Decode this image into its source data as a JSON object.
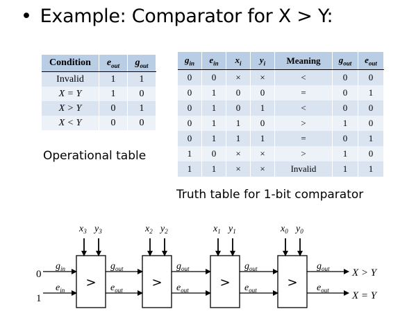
{
  "title": {
    "bullet": "•",
    "text": "Example: Comparator for X > Y:"
  },
  "operational_table": {
    "caption": "Operational table",
    "headers": [
      "Condition",
      "eout",
      "gout"
    ],
    "rows": [
      [
        "Invalid",
        "1",
        "1"
      ],
      [
        "X = Y",
        "1",
        "0"
      ],
      [
        "X > Y",
        "0",
        "1"
      ],
      [
        "X < Y",
        "0",
        "0"
      ]
    ]
  },
  "truth_table": {
    "caption": "Truth table for 1-bit comparator",
    "headers": [
      "gin",
      "ein",
      "xi",
      "yi",
      "Meaning",
      "gout",
      "eout"
    ],
    "rows": [
      [
        "0",
        "0",
        "×",
        "×",
        "<",
        "0",
        "0"
      ],
      [
        "0",
        "1",
        "0",
        "0",
        "=",
        "0",
        "1"
      ],
      [
        "0",
        "1",
        "0",
        "1",
        "<",
        "0",
        "0"
      ],
      [
        "0",
        "1",
        "1",
        "0",
        ">",
        "1",
        "0"
      ],
      [
        "0",
        "1",
        "1",
        "1",
        "=",
        "0",
        "1"
      ],
      [
        "1",
        "0",
        "×",
        "×",
        ">",
        "1",
        "0"
      ],
      [
        "1",
        "1",
        "×",
        "×",
        "Invalid",
        "1",
        "1"
      ]
    ]
  },
  "circuit": {
    "input_g": "0",
    "input_e": "1",
    "block_symbol": ">",
    "in_g_label": "g",
    "in_g_sub": "in",
    "in_e_label": "e",
    "in_e_sub": "in",
    "out_g_label": "g",
    "out_e_label": "e",
    "out_sub": "out",
    "out_g_result": "X > Y",
    "out_e_result": "X = Y",
    "stages": [
      {
        "x_label": "x",
        "x_sub": "3",
        "y_label": "y",
        "y_sub": "3"
      },
      {
        "x_label": "x",
        "x_sub": "2",
        "y_label": "y",
        "y_sub": "2"
      },
      {
        "x_label": "x",
        "x_sub": "1",
        "y_label": "y",
        "y_sub": "1"
      },
      {
        "x_label": "x",
        "x_sub": "0",
        "y_label": "y",
        "y_sub": "0"
      }
    ]
  }
}
